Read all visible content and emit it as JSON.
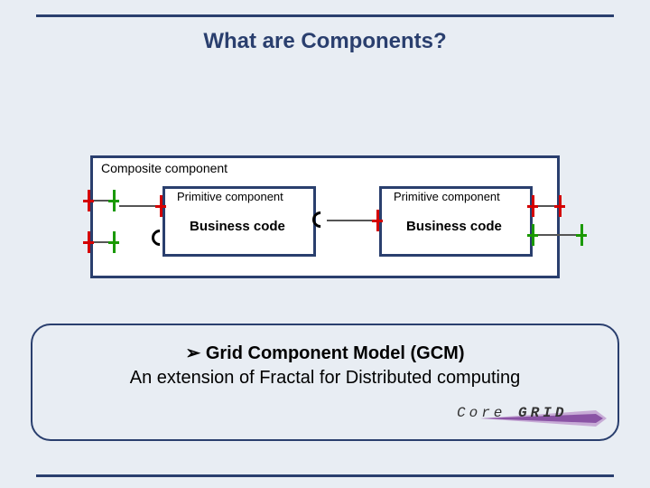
{
  "title": "What are Components?",
  "composite_label": "Composite component",
  "primitive_label": "Primitive component",
  "business_code": "Business code",
  "panel": {
    "bullet": "➢",
    "line1": "Grid Component Model (GCM)",
    "line2": "An extension of Fractal for Distributed computing"
  },
  "logo": {
    "text_left": "Core",
    "text_right": "GRID"
  },
  "colors": {
    "frame": "#2a3f6e",
    "red": "#d40000",
    "green": "#1a9900",
    "bg": "#e8edf3"
  }
}
